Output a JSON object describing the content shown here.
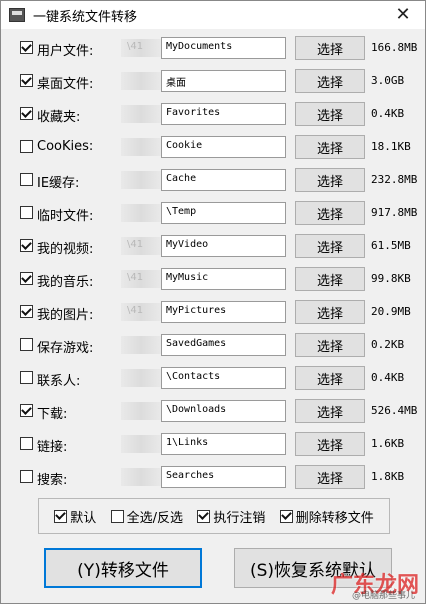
{
  "window": {
    "title": "一键系统文件转移",
    "close": "✕"
  },
  "rows": [
    {
      "label": "用户文件:",
      "checked": true,
      "blur": "\\41",
      "path": "MyDocuments",
      "button": "选择",
      "size": "166.8MB"
    },
    {
      "label": "桌面文件:",
      "checked": true,
      "blur": "",
      "path": "桌面",
      "button": "选择",
      "size": "3.0GB"
    },
    {
      "label": "收藏夹:",
      "checked": true,
      "blur": "",
      "path": "Favorites",
      "button": "选择",
      "size": "0.4KB"
    },
    {
      "label": "CooKies:",
      "checked": false,
      "blur": "",
      "path": "Cookie",
      "button": "选择",
      "size": "18.1KB"
    },
    {
      "label": "IE缓存:",
      "checked": false,
      "blur": "",
      "path": "Cache",
      "button": "选择",
      "size": "232.8MB"
    },
    {
      "label": "临时文件:",
      "checked": false,
      "blur": "",
      "path": "\\Temp",
      "button": "选择",
      "size": "917.8MB"
    },
    {
      "label": "我的视频:",
      "checked": true,
      "blur": "\\41",
      "path": "MyVideo",
      "button": "选择",
      "size": "61.5MB"
    },
    {
      "label": "我的音乐:",
      "checked": true,
      "blur": "\\41",
      "path": "MyMusic",
      "button": "选择",
      "size": "99.8KB"
    },
    {
      "label": "我的图片:",
      "checked": true,
      "blur": "\\41",
      "path": "MyPictures",
      "button": "选择",
      "size": "20.9MB"
    },
    {
      "label": "保存游戏:",
      "checked": false,
      "blur": "",
      "path": "SavedGames",
      "button": "选择",
      "size": "0.2KB"
    },
    {
      "label": "联系人:",
      "checked": false,
      "blur": "",
      "path": "\\Contacts",
      "button": "选择",
      "size": "0.4KB"
    },
    {
      "label": "下载:",
      "checked": true,
      "blur": "",
      "path": "\\Downloads",
      "button": "选择",
      "size": "526.4MB"
    },
    {
      "label": "链接:",
      "checked": false,
      "blur": "",
      "path": "1\\Links",
      "button": "选择",
      "size": "1.6KB"
    },
    {
      "label": "搜索:",
      "checked": false,
      "blur": "",
      "path": "Searches",
      "button": "选择",
      "size": "1.8KB"
    }
  ],
  "options": [
    {
      "label": "默认",
      "checked": true
    },
    {
      "label": "全选/反选",
      "checked": false
    },
    {
      "label": "执行注销",
      "checked": true
    },
    {
      "label": "删除转移文件",
      "checked": true
    }
  ],
  "buttons": {
    "transfer": "(Y)转移文件",
    "restore": "(S)恢复系统默认"
  },
  "watermark": {
    "main": "广东龙网",
    "sub": "@电脑那些事儿"
  }
}
